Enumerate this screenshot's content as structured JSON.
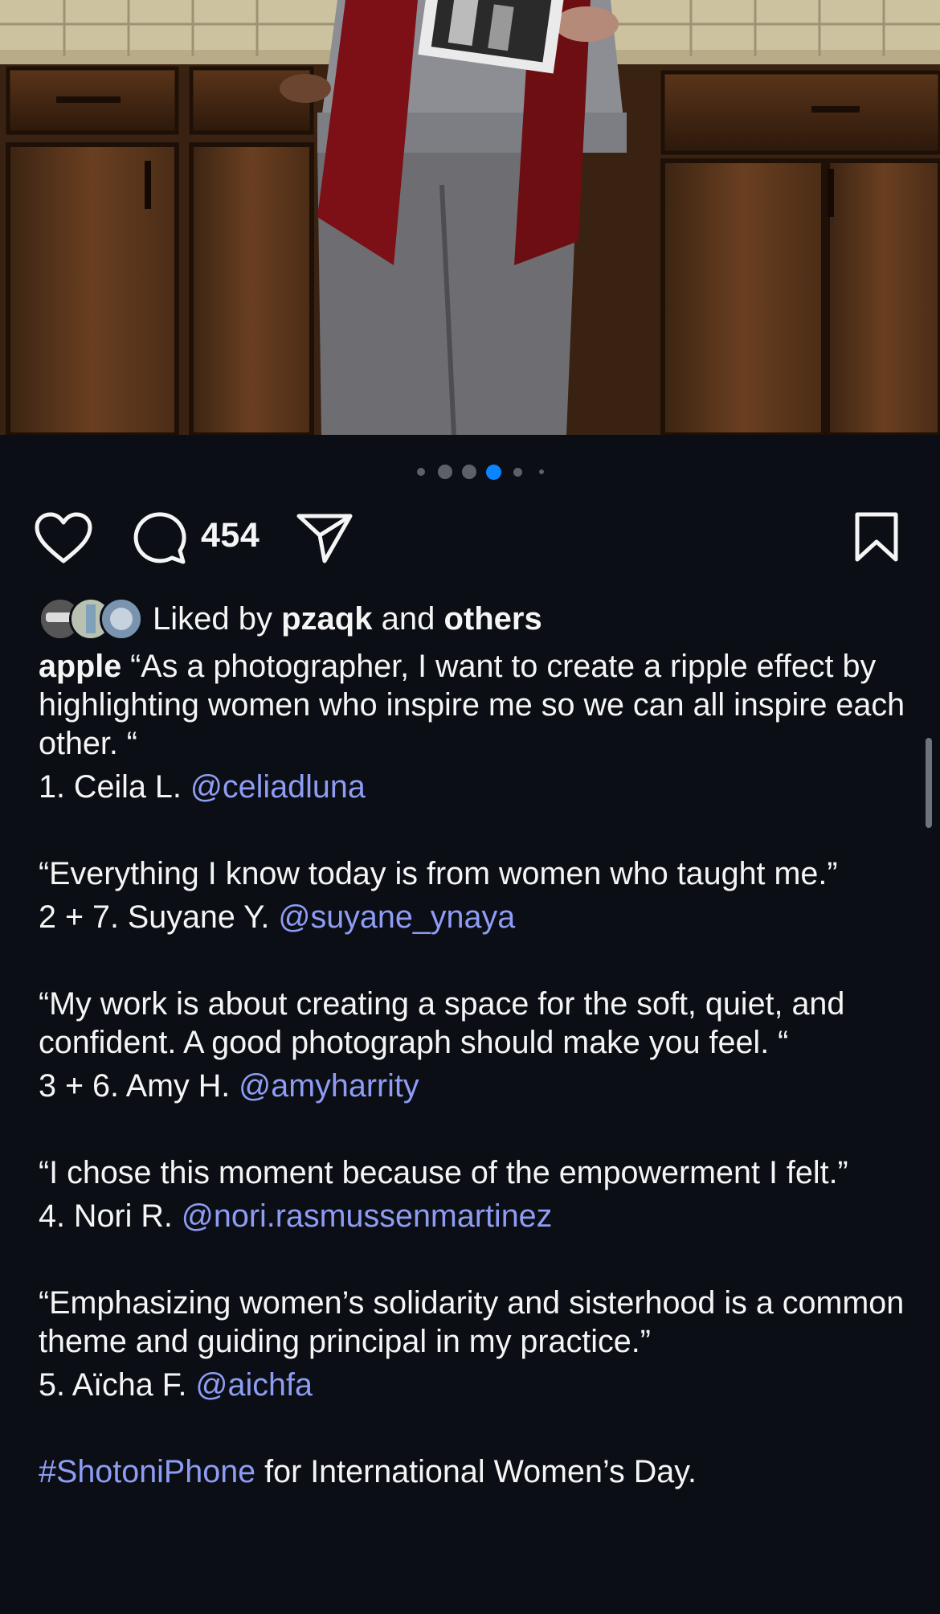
{
  "post": {
    "carousel": {
      "total": 6,
      "active_index": 3
    },
    "comment_count": "454",
    "likes": {
      "prefix": "Liked by ",
      "user": "pzaqk",
      "conjunction": " and ",
      "others": "others"
    },
    "caption": {
      "author": "apple",
      "intro": " “As a photographer, I want to create a ripple effect by highlighting women who inspire me so we can all inspire each other. “",
      "entries": [
        {
          "credit": "1. Ceila L. ",
          "handle": "@celiadluna",
          "quote": "“Everything I know today is from women who taught me.”"
        },
        {
          "credit": "2 + 7. Suyane Y. ",
          "handle": "@suyane_ynaya",
          "quote": "“My work is about creating a space for the soft, quiet, and confident.  A good photograph should make you feel. “"
        },
        {
          "credit": "3 + 6. Amy H. ",
          "handle": "@amyharrity",
          "quote": "“I chose this moment because of the empowerment I felt.”"
        },
        {
          "credit": "4. Nori R. ",
          "handle": "@nori.rasmussenmartinez",
          "quote": "“Emphasizing women’s solidarity and sisterhood is a common theme and guiding principal in my practice.”"
        },
        {
          "credit": "5. Aïcha F. ",
          "handle": "@aichfa"
        }
      ],
      "hashtag": "#ShotoniPhone",
      "closing": " for International Women’s Day."
    }
  },
  "colors": {
    "background": "#0b0e14",
    "text": "#f5f5f5",
    "link": "#8e9cf4",
    "active_dot": "#0a84ff",
    "inactive_dot": "#5d6068"
  },
  "icons": {
    "like": "heart-icon",
    "comment": "comment-bubble-icon",
    "share": "paper-plane-icon",
    "save": "bookmark-icon"
  }
}
